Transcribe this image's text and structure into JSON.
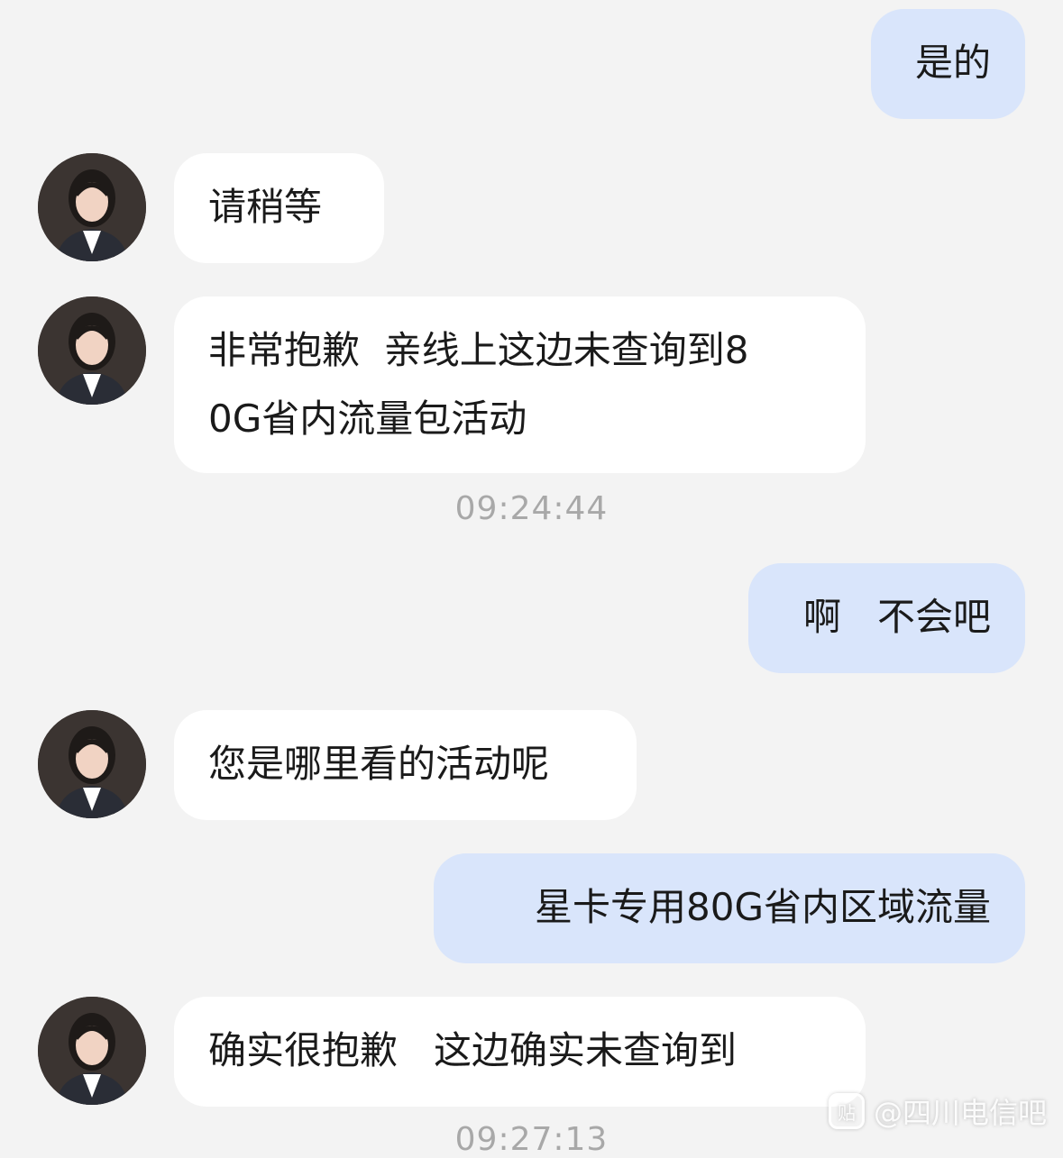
{
  "messages": [
    {
      "sender": "me",
      "text": "是的"
    },
    {
      "sender": "agent",
      "text": "请稍等"
    },
    {
      "sender": "agent",
      "text": "非常抱歉  亲线上这边未查询到8\n0G省内流量包活动"
    },
    {
      "type": "timestamp",
      "text": "09:24:44"
    },
    {
      "sender": "me",
      "text": "啊   不会吧"
    },
    {
      "sender": "agent",
      "text": "您是哪里看的活动呢"
    },
    {
      "sender": "me",
      "text": "星卡专用80G省内区域流量"
    },
    {
      "sender": "agent",
      "text": "确实很抱歉   这边确实未查询到"
    },
    {
      "type": "timestamp",
      "text": "09:27:13"
    }
  ],
  "watermark": {
    "text": "@四川电信吧"
  },
  "colors": {
    "background": "#f3f3f3",
    "me_bubble": "#d9e5fb",
    "agent_bubble": "#ffffff",
    "timestamp": "#a8a8a8"
  },
  "icons": {
    "agent_avatar": "customer-service-agent-avatar"
  }
}
